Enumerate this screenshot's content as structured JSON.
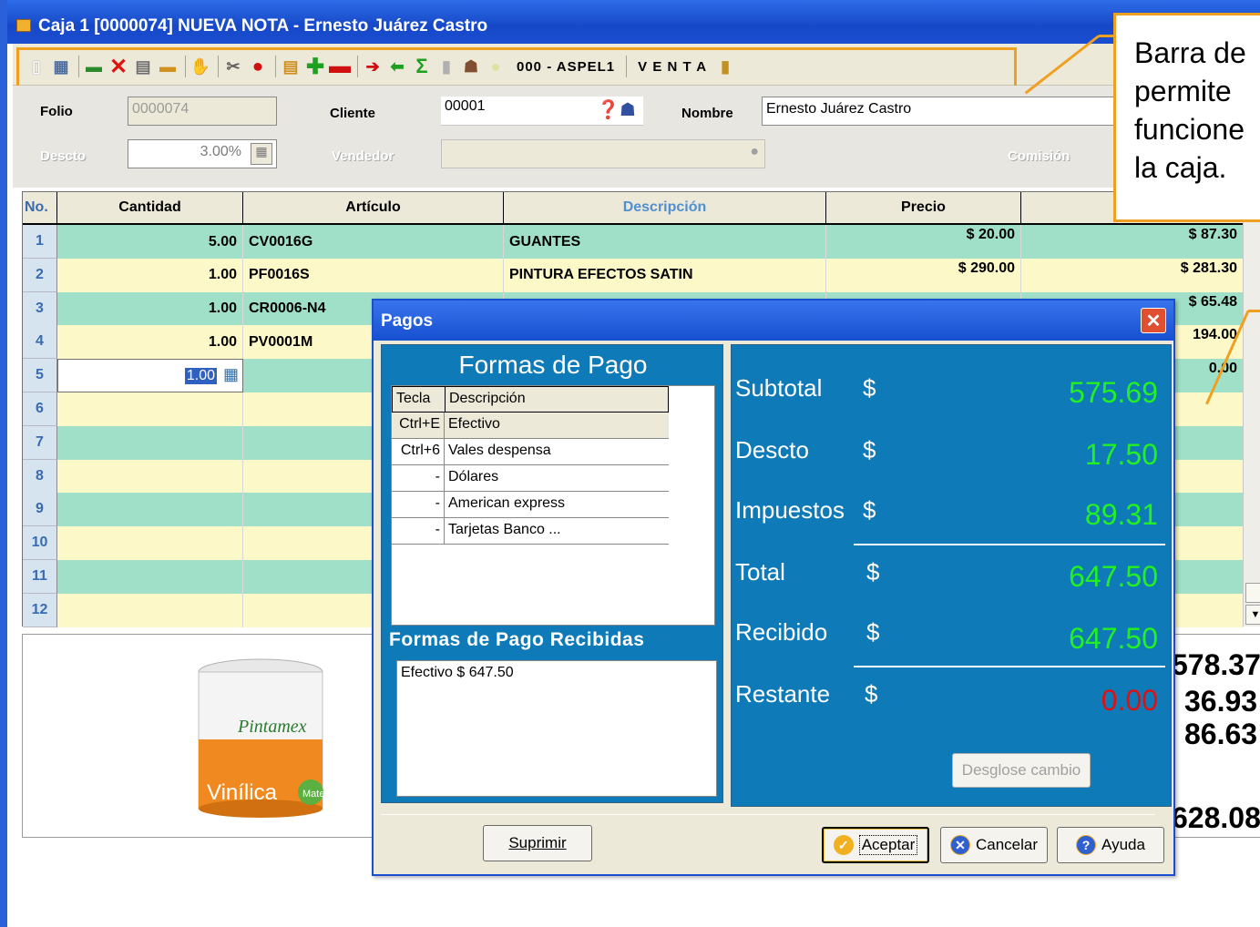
{
  "window": {
    "title": "Caja 1 [0000074] NUEVA NOTA - Ernesto Juárez Castro"
  },
  "toolbar": {
    "code_label": "000 - ASPEL1",
    "mode_label": "V E N T A"
  },
  "form": {
    "folio_label": "Folio",
    "folio_value": "0000074",
    "cliente_label": "Cliente",
    "cliente_value": "00001",
    "nombre_label": "Nombre",
    "nombre_value": "Ernesto Juárez Castro",
    "descto_label": "Descto",
    "descto_value": "3.00%",
    "vendedor_label": "Vendedor",
    "comision_label": "Comisión"
  },
  "grid": {
    "headers": {
      "no": "No.",
      "cantidad": "Cantidad",
      "articulo": "Artículo",
      "descripcion": "Descripción",
      "precio": "Precio"
    },
    "rows": [
      {
        "no": "1",
        "cantidad": "5.00",
        "articulo": "CV0016G",
        "descripcion": "GUANTES",
        "precio": "$ 20.00",
        "importe": "$ 87.30"
      },
      {
        "no": "2",
        "cantidad": "1.00",
        "articulo": "PF0016S",
        "descripcion": "PINTURA EFECTOS SATIN",
        "precio": "$ 290.00",
        "importe": "$ 281.30"
      },
      {
        "no": "3",
        "cantidad": "1.00",
        "articulo": "CR0006-N4",
        "descripcion": "",
        "precio": "",
        "importe": "$ 65.48"
      },
      {
        "no": "4",
        "cantidad": "1.00",
        "articulo": "PV0001M",
        "descripcion": "",
        "precio": "",
        "importe": "194.00"
      },
      {
        "no": "5",
        "cantidad": "1.00",
        "articulo": "",
        "descripcion": "",
        "precio": "",
        "importe": "0.00"
      },
      {
        "no": "6",
        "cantidad": "",
        "articulo": "",
        "descripcion": "",
        "precio": "",
        "importe": ""
      },
      {
        "no": "7",
        "cantidad": "",
        "articulo": "",
        "descripcion": "",
        "precio": "",
        "importe": ""
      },
      {
        "no": "8",
        "cantidad": "",
        "articulo": "",
        "descripcion": "",
        "precio": "",
        "importe": ""
      },
      {
        "no": "9",
        "cantidad": "",
        "articulo": "",
        "descripcion": "",
        "precio": "",
        "importe": ""
      },
      {
        "no": "10",
        "cantidad": "",
        "articulo": "",
        "descripcion": "",
        "precio": "",
        "importe": ""
      },
      {
        "no": "11",
        "cantidad": "",
        "articulo": "",
        "descripcion": "",
        "precio": "",
        "importe": ""
      },
      {
        "no": "12",
        "cantidad": "",
        "articulo": "",
        "descripcion": "",
        "precio": "",
        "importe": ""
      }
    ]
  },
  "product_image": {
    "brand": "Pintamex",
    "line": "Vinílica",
    "badge": "Mate"
  },
  "totals_behind": [
    "578.37",
    "36.93",
    "86.63",
    "628.08"
  ],
  "callout": {
    "text": [
      "Barra de",
      "permite",
      "funcione",
      "la caja."
    ]
  },
  "dialog": {
    "title": "Pagos",
    "formas_title": "Formas de Pago",
    "table_headers": {
      "tecla": "Tecla",
      "descripcion": "Descripción"
    },
    "formas": [
      {
        "tecla": "Ctrl+E",
        "descripcion": "Efectivo"
      },
      {
        "tecla": "Ctrl+6",
        "descripcion": "Vales despensa"
      },
      {
        "tecla": "-",
        "descripcion": "Dólares"
      },
      {
        "tecla": "-",
        "descripcion": "American express"
      },
      {
        "tecla": "-",
        "descripcion": "Tarjetas Banco ..."
      }
    ],
    "recibidas_title": "Formas de Pago Recibidas",
    "recibidas": "Efectivo $ 647.50",
    "summary": {
      "subtotal_label": "Subtotal",
      "subtotal": "575.69",
      "descto_label": "Descto",
      "descto": "17.50",
      "impuestos_label": "Impuestos",
      "impuestos": "89.31",
      "total_label": "Total",
      "total": "647.50",
      "recibido_label": "Recibido",
      "recibido": "647.50",
      "restante_label": "Restante",
      "restante": "0.00",
      "currency": "$"
    },
    "desglose_label": "Desglose cambio",
    "suprimir_label": "Suprimir",
    "aceptar_label": "Aceptar",
    "cancelar_label": "Cancelar",
    "ayuda_label": "Ayuda"
  },
  "colors": {
    "row_green": "#a0e0c8",
    "row_yellow": "#fcf8c8",
    "panel_blue": "#0f7ab8",
    "value_green": "#22f022",
    "value_red": "#e01010",
    "highlight_orange": "#f0a020"
  }
}
